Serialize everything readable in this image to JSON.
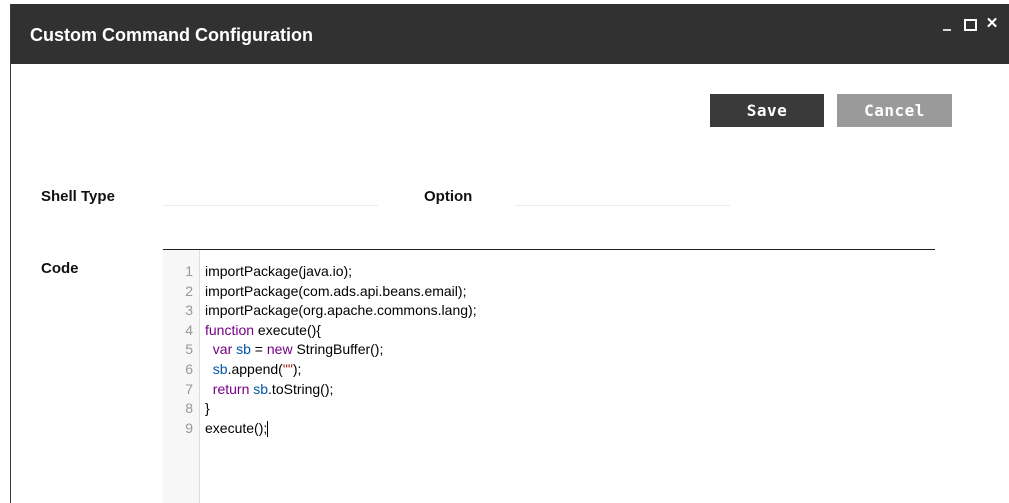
{
  "window": {
    "title": "Custom Command Configuration",
    "controls": {
      "minimize": "_",
      "maximize": "□",
      "close": "✕"
    }
  },
  "toolbar": {
    "save_label": "Save",
    "cancel_label": "Cancel"
  },
  "form": {
    "shell_type_label": "Shell Type",
    "option_label": "Option",
    "code_label": "Code",
    "shell_type_value": "",
    "option_value": ""
  },
  "editor": {
    "lines": [
      {
        "n": "1",
        "text": "importPackage(java.io);"
      },
      {
        "n": "2",
        "text": "importPackage(com.ads.api.beans.email);"
      },
      {
        "n": "3",
        "text": "importPackage(org.apache.commons.lang);"
      },
      {
        "n": "4",
        "text": "function execute(){"
      },
      {
        "n": "5",
        "text": "  var sb = new StringBuffer();"
      },
      {
        "n": "6",
        "text": "  sb.append(\"\");"
      },
      {
        "n": "7",
        "text": "  return sb.toString();"
      },
      {
        "n": "8",
        "text": "}"
      },
      {
        "n": "9",
        "text": "execute();"
      }
    ]
  },
  "colors": {
    "titlebar": "#313131",
    "save_button": "#3a3a3a",
    "cancel_button": "#9a9a9a",
    "keyword": "#770088",
    "variable": "#0055aa",
    "string": "#aa1111"
  }
}
